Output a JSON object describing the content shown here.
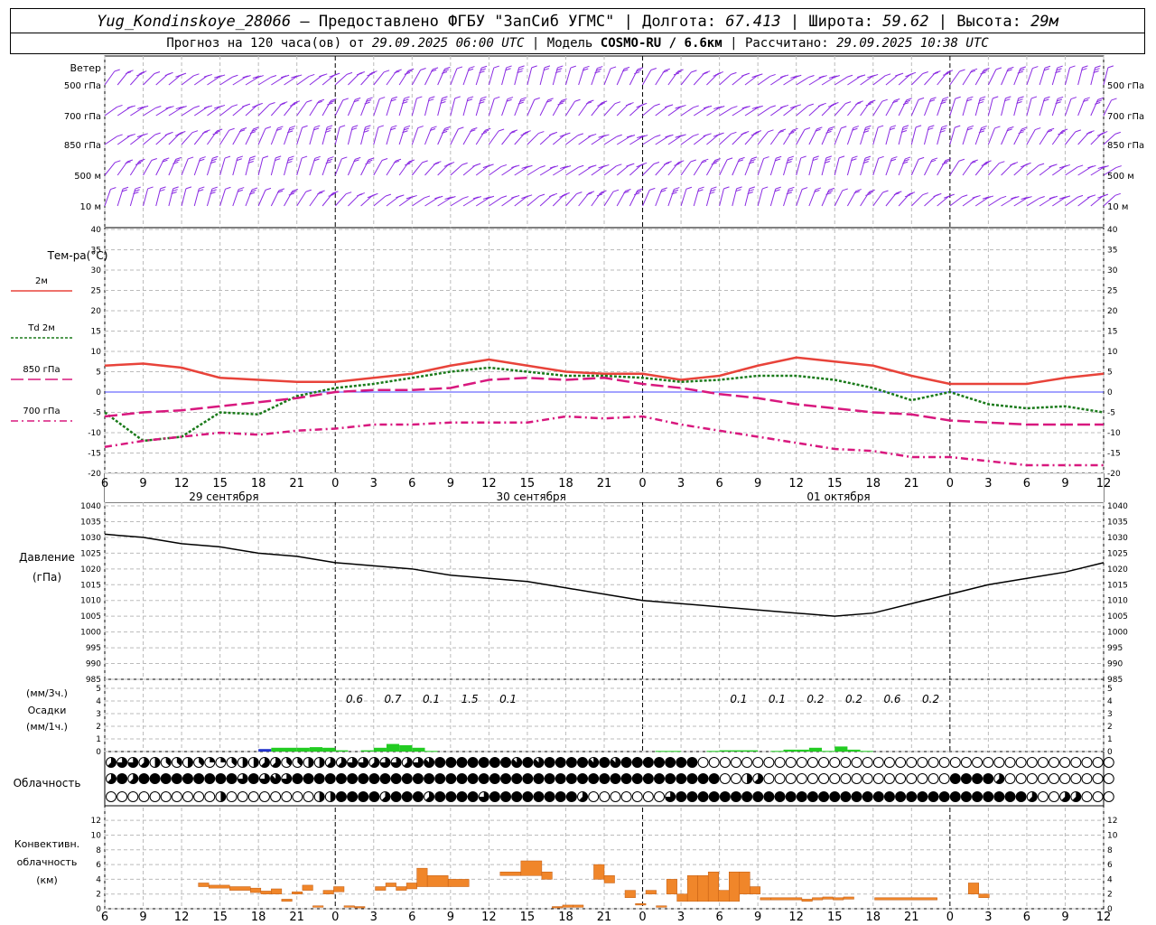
{
  "header": {
    "station": "Yug_Kondinskoye_28066",
    "provider": "Предоставлено ФГБУ \"ЗапСиб УГМС\"",
    "lon_label": "Долгота:",
    "lon_value": "67.413",
    "lat_label": "Широта:",
    "lat_value": "59.62",
    "alt_label": "Высота:",
    "alt_value": "29м",
    "forecast_label": "Прогноз на 120 часа(ов) от",
    "forecast_start": "29.09.2025 06:00 UTC",
    "model_label": "Модель",
    "model_value": "COSMO-RU / 6.6км",
    "calc_label": "Рассчитано:",
    "calc_value": "29.09.2025 10:38 UTC"
  },
  "time_axis": {
    "tick_labels": [
      "6",
      "9",
      "12",
      "15",
      "18",
      "21",
      "0",
      "3",
      "6",
      "9",
      "12",
      "15",
      "18",
      "21",
      "0",
      "3",
      "6",
      "9",
      "12",
      "15",
      "18",
      "21",
      "0",
      "3",
      "6",
      "9",
      "12"
    ],
    "day_labels": [
      "29 сентября",
      "30 сентября",
      "01 октября"
    ]
  },
  "labels": {
    "wind_title": "Ветер",
    "wind_levels": [
      "500 гПа",
      "700 гПа",
      "850 гПа",
      "500 м",
      "10 м"
    ],
    "temp_title": "Тем-ра(°C)",
    "pres_title_1": "Давление",
    "pres_title_2": "(гПа)",
    "prec_title_1": "(мм/3ч.)",
    "prec_title_2": "Осадки",
    "prec_title_3": "(мм/1ч.)",
    "cloud_title": "Облачность",
    "conv_title_1": "Конвективн.",
    "conv_title_2": "облачность",
    "conv_title_3": "(км)"
  },
  "colors": {
    "t2m": "#e8433a",
    "td": "#1a7a1a",
    "t850": "#d8187e",
    "wind": "#8a2be2",
    "prec": "#22cc22",
    "prec_blue": "#2233cc",
    "conv": "#f0862a",
    "zero_line": "#4444ff"
  },
  "chart_data": [
    {
      "type": "line",
      "title": "Тем-ра(°C)",
      "x_hours": [
        0,
        3,
        6,
        9,
        12,
        15,
        18,
        21,
        24,
        27,
        30,
        33,
        36,
        39,
        42,
        45,
        48,
        51,
        54,
        57,
        60,
        63,
        66,
        69,
        72,
        75,
        78
      ],
      "ylim": [
        -20,
        40
      ],
      "series": [
        {
          "name": "2м",
          "color": "#e8433a",
          "dash": "",
          "values": [
            6.5,
            7,
            6,
            3.5,
            3,
            2.5,
            2.5,
            3.5,
            4.5,
            6.5,
            8,
            6.5,
            5,
            4.5,
            4.5,
            3,
            4,
            6.5,
            8.5,
            7.5,
            6.5,
            4,
            2,
            2,
            2,
            3.5,
            4.5
          ]
        },
        {
          "name": "Td 2м",
          "color": "#1a7a1a",
          "dash": "3,2",
          "values": [
            -5,
            -12,
            -11,
            -5,
            -5.5,
            -1,
            1,
            2,
            3.5,
            5,
            6,
            5,
            4,
            4,
            3.5,
            2.5,
            3,
            4,
            4,
            3,
            1,
            -2,
            0,
            -3,
            -4,
            -3.5,
            -5
          ]
        },
        {
          "name": "850 гПа",
          "color": "#d8187e",
          "dash": "14,5",
          "values": [
            -6,
            -5,
            -4.5,
            -3.5,
            -2.5,
            -1.5,
            0,
            0.5,
            0.5,
            1,
            3,
            3.5,
            3,
            3.5,
            2,
            1,
            -0.5,
            -1.5,
            -3,
            -4,
            -5,
            -5.5,
            -7,
            -7.5,
            -8,
            -8,
            -8
          ]
        },
        {
          "name": "700 гПа",
          "color": "#d8187e",
          "dash": "8,4,2,4",
          "values": [
            -13.5,
            -12,
            -11,
            -10,
            -10.5,
            -9.5,
            -9,
            -8,
            -8,
            -7.5,
            -7.5,
            -7.5,
            -6,
            -6.5,
            -6,
            -8,
            -9.5,
            -11,
            -12.5,
            -14,
            -14.5,
            -16,
            -16,
            -17,
            -18,
            -18,
            -18
          ]
        }
      ]
    },
    {
      "type": "line",
      "title": "Давление",
      "ylabel": "(гПа)",
      "x_hours": [
        0,
        3,
        6,
        9,
        12,
        15,
        18,
        21,
        24,
        27,
        30,
        33,
        36,
        39,
        42,
        45,
        48,
        51,
        54,
        57,
        60,
        63,
        66,
        69,
        72,
        75,
        78
      ],
      "ylim": [
        985,
        1040
      ],
      "series": [
        {
          "name": "Давление",
          "values": [
            1031,
            1030,
            1028,
            1027,
            1025,
            1024,
            1022,
            1021,
            1020,
            1018,
            1017,
            1016,
            1014,
            1012,
            1010,
            1009,
            1008,
            1007,
            1006,
            1005,
            1006,
            1009,
            1012,
            1015,
            1017,
            1019,
            1022
          ]
        }
      ]
    },
    {
      "type": "bar",
      "title": "Осадки",
      "x_hours": [
        15,
        16,
        17,
        18,
        19,
        20,
        21,
        22,
        23,
        24,
        25,
        26,
        27,
        28,
        29,
        30,
        31,
        32,
        33,
        34,
        35,
        36,
        37,
        38,
        39,
        40,
        41,
        42,
        43,
        44,
        45,
        46,
        47,
        48,
        49,
        50,
        51,
        52,
        53,
        54,
        55,
        56,
        57,
        58,
        59,
        60,
        61,
        62,
        63,
        64,
        65,
        66,
        67,
        68,
        69,
        70,
        71,
        72,
        73,
        74,
        75,
        76,
        77,
        78
      ],
      "ylim": [
        0,
        5
      ],
      "annotations_3h": [
        {
          "hour": 19.5,
          "text": "0.6"
        },
        {
          "hour": 22.5,
          "text": "0.7"
        },
        {
          "hour": 25.5,
          "text": "0.1"
        },
        {
          "hour": 28.5,
          "text": "1.5"
        },
        {
          "hour": 31.5,
          "text": "0.1"
        },
        {
          "hour": 49.5,
          "text": "0.1"
        },
        {
          "hour": 52.5,
          "text": "0.1"
        },
        {
          "hour": 55.5,
          "text": "0.2"
        },
        {
          "hour": 58.5,
          "text": "0.2"
        },
        {
          "hour": 61.5,
          "text": "0.6"
        },
        {
          "hour": 64.5,
          "text": "0.2"
        }
      ],
      "hourly": [
        {
          "hour": 12,
          "value": 0.2,
          "kind": "snow"
        },
        {
          "hour": 13,
          "value": 0.3
        },
        {
          "hour": 14,
          "value": 0.3
        },
        {
          "hour": 15,
          "value": 0.3
        },
        {
          "hour": 16,
          "value": 0.35
        },
        {
          "hour": 17,
          "value": 0.3
        },
        {
          "hour": 18,
          "value": 0.1
        },
        {
          "hour": 20,
          "value": 0.1
        },
        {
          "hour": 21,
          "value": 0.3
        },
        {
          "hour": 22,
          "value": 0.6
        },
        {
          "hour": 23,
          "value": 0.5
        },
        {
          "hour": 24,
          "value": 0.3
        },
        {
          "hour": 25,
          "value": 0.05
        },
        {
          "hour": 43,
          "value": 0.05
        },
        {
          "hour": 44,
          "value": 0.05
        },
        {
          "hour": 47,
          "value": 0.05
        },
        {
          "hour": 48,
          "value": 0.1
        },
        {
          "hour": 49,
          "value": 0.1
        },
        {
          "hour": 50,
          "value": 0.1
        },
        {
          "hour": 52,
          "value": 0.05
        },
        {
          "hour": 53,
          "value": 0.15
        },
        {
          "hour": 54,
          "value": 0.15
        },
        {
          "hour": 55,
          "value": 0.3
        },
        {
          "hour": 56,
          "value": 0.05
        },
        {
          "hour": 57,
          "value": 0.4
        },
        {
          "hour": 58,
          "value": 0.15
        },
        {
          "hour": 59,
          "value": 0.05
        }
      ]
    },
    {
      "type": "table",
      "title": "Облачность",
      "rows_description": "3 rows of hourly cloud cover octas (0=clear .. 8=overcast)",
      "row1": [
        5,
        6,
        6,
        5,
        4,
        3,
        3,
        4,
        3,
        2,
        2,
        3,
        4,
        4,
        5,
        5,
        3,
        3,
        4,
        4,
        5,
        5,
        6,
        6,
        5,
        6,
        6,
        5,
        6,
        7,
        8,
        8,
        8,
        8,
        8,
        8,
        8,
        7,
        8,
        7,
        8,
        8,
        8,
        8,
        7,
        8,
        7,
        8,
        8,
        8,
        8,
        8,
        8,
        8,
        0,
        0,
        0,
        0,
        0,
        0,
        0,
        0,
        0,
        0,
        0,
        0,
        0,
        0,
        0,
        0,
        0,
        0,
        0,
        0,
        0,
        0,
        0,
        0,
        0,
        0,
        0,
        0,
        0,
        0,
        0,
        0,
        0,
        0,
        0,
        0,
        0,
        0
      ],
      "row2": [
        5,
        8,
        5,
        8,
        8,
        8,
        8,
        8,
        8,
        8,
        8,
        8,
        6,
        8,
        6,
        7,
        6,
        8,
        8,
        8,
        8,
        8,
        8,
        8,
        8,
        8,
        8,
        8,
        8,
        8,
        8,
        8,
        8,
        8,
        8,
        8,
        8,
        8,
        8,
        8,
        8,
        8,
        8,
        8,
        8,
        8,
        8,
        8,
        8,
        8,
        8,
        8,
        8,
        8,
        8,
        8,
        0,
        0,
        4,
        5,
        0,
        0,
        0,
        0,
        0,
        0,
        0,
        0,
        0,
        0,
        0,
        0,
        0,
        0,
        0,
        0,
        0,
        8,
        8,
        8,
        8,
        5,
        0,
        0,
        0,
        0,
        0,
        0,
        0,
        0,
        0,
        0
      ],
      "row3": [
        0,
        0,
        0,
        0,
        0,
        0,
        0,
        0,
        0,
        0,
        4,
        0,
        0,
        0,
        0,
        0,
        0,
        0,
        0,
        4,
        4,
        8,
        8,
        8,
        8,
        5,
        8,
        8,
        8,
        5,
        8,
        8,
        8,
        8,
        6,
        8,
        8,
        8,
        8,
        8,
        8,
        8,
        8,
        5,
        0,
        0,
        0,
        0,
        0,
        0,
        0,
        6,
        8,
        8,
        8,
        8,
        8,
        8,
        8,
        8,
        8,
        8,
        8,
        8,
        8,
        8,
        8,
        8,
        8,
        8,
        8,
        8,
        8,
        8,
        8,
        8,
        8,
        8,
        8,
        8,
        8,
        8,
        8,
        8,
        5,
        0,
        0,
        5,
        5,
        0,
        0,
        0
      ]
    },
    {
      "type": "bar",
      "title": "Конвективн. облачность",
      "ylabel": "(км)",
      "ylim": [
        0,
        13
      ],
      "x_hours": [],
      "segments": [
        {
          "h1": 9,
          "h2": 10,
          "bottom": 3,
          "top": 3.5
        },
        {
          "h1": 10,
          "h2": 12,
          "bottom": 2.8,
          "top": 3.2
        },
        {
          "h1": 12,
          "h2": 14,
          "bottom": 2.5,
          "top": 3
        },
        {
          "h1": 14,
          "h2": 15,
          "bottom": 2.2,
          "top": 2.8
        },
        {
          "h1": 15,
          "h2": 16,
          "bottom": 2,
          "top": 2.4
        },
        {
          "h1": 16,
          "h2": 17,
          "bottom": 2,
          "top": 2.7
        },
        {
          "h1": 17,
          "h2": 18,
          "bottom": 1,
          "top": 1.3
        },
        {
          "h1": 18,
          "h2": 19,
          "bottom": 2,
          "top": 2.3
        },
        {
          "h1": 19,
          "h2": 20,
          "bottom": 2.5,
          "top": 3.2
        },
        {
          "h1": 20,
          "h2": 21,
          "bottom": 0.2,
          "top": 0.4
        },
        {
          "h1": 21,
          "h2": 22,
          "bottom": 2,
          "top": 2.5
        },
        {
          "h1": 22,
          "h2": 23,
          "bottom": 2.3,
          "top": 3
        },
        {
          "h1": 23,
          "h2": 24,
          "bottom": 0.2,
          "top": 0.4
        },
        {
          "h1": 24,
          "h2": 25,
          "bottom": 0.2,
          "top": 0.3
        },
        {
          "h1": 26,
          "h2": 27,
          "bottom": 2.5,
          "top": 3
        },
        {
          "h1": 27,
          "h2": 28,
          "bottom": 3,
          "top": 3.5
        },
        {
          "h1": 28,
          "h2": 29,
          "bottom": 2.5,
          "top": 3
        },
        {
          "h1": 29,
          "h2": 30,
          "bottom": 2.7,
          "top": 3.5
        },
        {
          "h1": 30,
          "h2": 31,
          "bottom": 3,
          "top": 5.5
        },
        {
          "h1": 31,
          "h2": 33,
          "bottom": 3,
          "top": 4.5
        },
        {
          "h1": 33,
          "h2": 35,
          "bottom": 3,
          "top": 4
        },
        {
          "h1": 38,
          "h2": 40,
          "bottom": 4.5,
          "top": 5
        },
        {
          "h1": 40,
          "h2": 42,
          "bottom": 4.5,
          "top": 6.5
        },
        {
          "h1": 42,
          "h2": 43,
          "bottom": 4,
          "top": 5
        },
        {
          "h1": 43,
          "h2": 44,
          "bottom": 0.2,
          "top": 0.3
        },
        {
          "h1": 44,
          "h2": 45,
          "bottom": 0.2,
          "top": 0.5
        },
        {
          "h1": 45,
          "h2": 46,
          "bottom": 0.2,
          "top": 0.5
        },
        {
          "h1": 47,
          "h2": 48,
          "bottom": 4,
          "top": 6
        },
        {
          "h1": 48,
          "h2": 49,
          "bottom": 3.5,
          "top": 4.5
        },
        {
          "h1": 50,
          "h2": 51,
          "bottom": 1.5,
          "top": 2.5
        },
        {
          "h1": 51,
          "h2": 52,
          "bottom": 0.5,
          "top": 0.7
        },
        {
          "h1": 52,
          "h2": 53,
          "bottom": 2,
          "top": 2.5
        },
        {
          "h1": 53,
          "h2": 54,
          "bottom": 0.2,
          "top": 0.4
        },
        {
          "h1": 54,
          "h2": 55,
          "bottom": 2,
          "top": 4
        },
        {
          "h1": 55,
          "h2": 56,
          "bottom": 1,
          "top": 2
        },
        {
          "h1": 56,
          "h2": 57,
          "bottom": 1,
          "top": 4.5
        },
        {
          "h1": 57,
          "h2": 58,
          "bottom": 1,
          "top": 4.5
        },
        {
          "h1": 58,
          "h2": 59,
          "bottom": 1,
          "top": 5
        },
        {
          "h1": 59,
          "h2": 60,
          "bottom": 1,
          "top": 2.5
        },
        {
          "h1": 60,
          "h2": 61,
          "bottom": 1,
          "top": 5
        },
        {
          "h1": 61,
          "h2": 62,
          "bottom": 2,
          "top": 5
        },
        {
          "h1": 62,
          "h2": 63,
          "bottom": 2,
          "top": 3
        },
        {
          "h1": 63,
          "h2": 64,
          "bottom": 1.2,
          "top": 1.5
        },
        {
          "h1": 64,
          "h2": 67,
          "bottom": 1.2,
          "top": 1.5
        },
        {
          "h1": 67,
          "h2": 68,
          "bottom": 1,
          "top": 1.3
        },
        {
          "h1": 68,
          "h2": 69,
          "bottom": 1.2,
          "top": 1.5
        },
        {
          "h1": 69,
          "h2": 70,
          "bottom": 1.3,
          "top": 1.6
        },
        {
          "h1": 70,
          "h2": 71,
          "bottom": 1.2,
          "top": 1.5
        },
        {
          "h1": 71,
          "h2": 72,
          "bottom": 1.3,
          "top": 1.6
        },
        {
          "h1": 74,
          "h2": 80,
          "bottom": 1.2,
          "top": 1.5
        },
        {
          "h1": 83,
          "h2": 84,
          "bottom": 2,
          "top": 3.5
        },
        {
          "h1": 84,
          "h2": 85,
          "bottom": 1.5,
          "top": 2
        }
      ]
    }
  ]
}
